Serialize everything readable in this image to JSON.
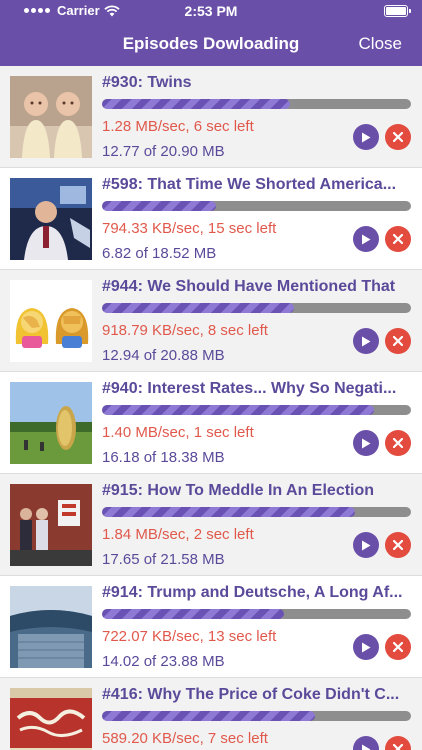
{
  "status_bar": {
    "carrier": "Carrier",
    "time": "2:53 PM"
  },
  "header": {
    "title": "Episodes Dowloading",
    "close_label": "Close"
  },
  "colors": {
    "header": "#6a4fa8",
    "title_text": "#5b4a9a",
    "speed_text": "#e0594c",
    "play_button": "#6a4fa8",
    "cancel_button": "#e24b3e",
    "progress_track": "#8e8e8e"
  },
  "episodes": [
    {
      "title": "#930: Twins",
      "speed": "1.28 MB/sec, 6 sec  left",
      "size": "12.77 of 20.90 MB",
      "progress": 0.61,
      "thumb_icon": "twins-photo"
    },
    {
      "title": "#598: That Time We Shorted America...",
      "speed": "794.33 KB/sec, 15 sec  left",
      "size": "6.82 of 18.52 MB",
      "progress": 0.37,
      "thumb_icon": "trader-photo"
    },
    {
      "title": "#944: We Should Have Mentioned That",
      "speed": "918.79 KB/sec, 8 sec  left",
      "size": "12.94 of 20.88 MB",
      "progress": 0.62,
      "thumb_icon": "facepalm-emoji"
    },
    {
      "title": "#940: Interest Rates... Why So Negati...",
      "speed": "1.40 MB/sec, 1 sec  left",
      "size": "16.18 of 18.38 MB",
      "progress": 0.88,
      "thumb_icon": "coin-sculpture-photo"
    },
    {
      "title": "#915: How To Meddle In An Election",
      "speed": "1.84 MB/sec, 2 sec  left",
      "size": "17.65 of 21.58 MB",
      "progress": 0.82,
      "thumb_icon": "voting-photo"
    },
    {
      "title": "#914: Trump and Deutsche, A Long Af...",
      "speed": "722.07 KB/sec, 13 sec  left",
      "size": "14.02 of 23.88 MB",
      "progress": 0.59,
      "thumb_icon": "deutsche-bank-photo"
    },
    {
      "title": "#416: Why The Price of Coke Didn't C...",
      "speed": "589.20 KB/sec, 7 sec  left",
      "size": "",
      "progress": 0.69,
      "thumb_icon": "coca-cola-sign-photo"
    }
  ]
}
